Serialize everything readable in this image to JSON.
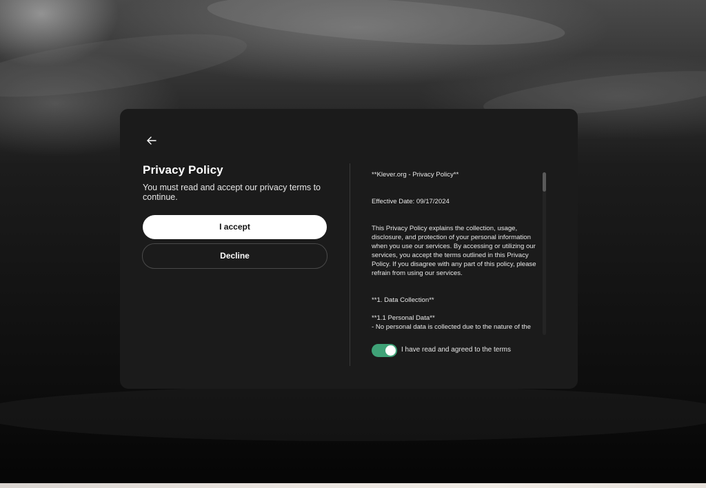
{
  "dialog": {
    "back_icon": "arrow-left-icon",
    "title": "Privacy Policy",
    "subtitle": "You must read and accept our privacy terms to continue.",
    "accept_label": "I accept",
    "decline_label": "Decline"
  },
  "policy": {
    "heading": "**Klever.org - Privacy Policy**",
    "effective_date": "Effective Date: 09/17/2024",
    "intro": "This Privacy Policy explains the collection, usage, disclosure, and protection of your personal information when you use our services. By accessing or utilizing our services, you accept the terms outlined in this Privacy Policy. If you disagree with any part of this policy, please refrain from using our services.",
    "section_1": "**1. Data Collection**",
    "section_1_1": "**1.1 Personal Data**",
    "section_1_1_text": "- No personal data is collected due to the nature of the"
  },
  "agreement": {
    "checked": true,
    "label": "I have read and agreed to the terms"
  },
  "colors": {
    "card_bg": "#1b1b1b",
    "toggle_on": "#3fa277",
    "accept_bg": "#ffffff"
  }
}
